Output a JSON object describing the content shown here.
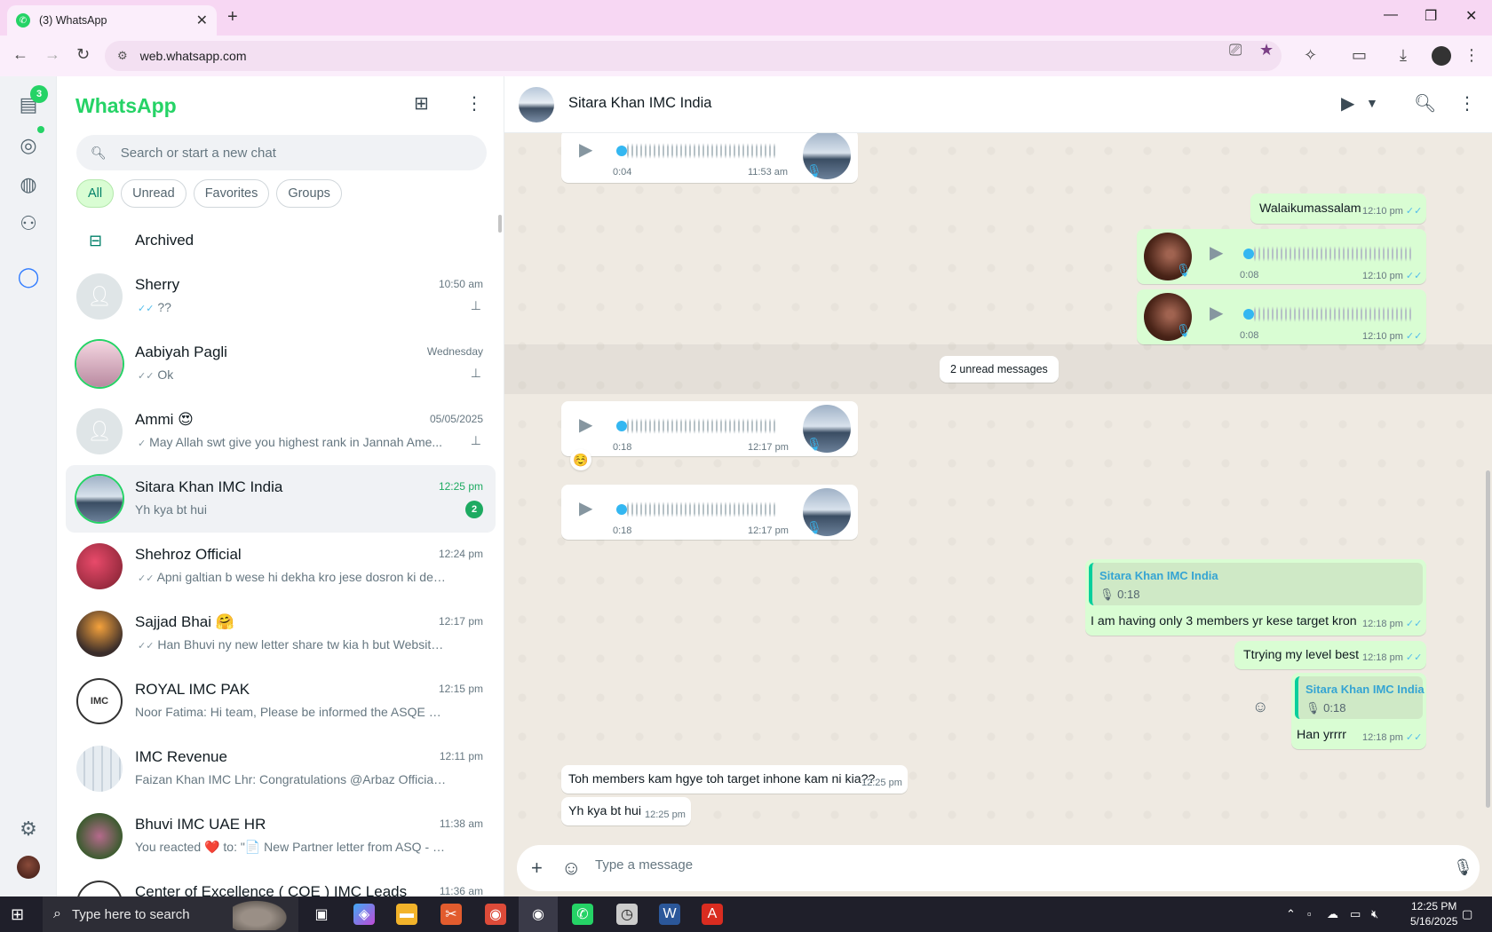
{
  "browser": {
    "tab_title": "(3) WhatsApp",
    "url": "web.whatsapp.com",
    "window_buttons": [
      "—",
      "❐",
      "✕"
    ]
  },
  "rail": {
    "chats_badge": "3"
  },
  "sidebar": {
    "brand": "WhatsApp",
    "search_placeholder": "Search or start a new chat",
    "filters": [
      "All",
      "Unread",
      "Favorites",
      "Groups"
    ],
    "archived_label": "Archived",
    "chats": [
      {
        "name": "Sherry",
        "time": "10:50 am",
        "tick": "✓✓",
        "preview": "??",
        "pinned": true
      },
      {
        "name": "Aabiyah Pagli",
        "time": "Wednesday",
        "tick": "✓✓",
        "preview": "Ok",
        "pinned": true
      },
      {
        "name": "Ammi 😍",
        "time": "05/05/2025",
        "tick": "✓",
        "preview": "May Allah swt give you highest rank in Jannah  Ame...",
        "pinned": true
      },
      {
        "name": "Sitara Khan IMC India",
        "time": "12:25 pm",
        "tick": "",
        "preview": "Yh kya bt hui",
        "unread": "2"
      },
      {
        "name": "Shehroz Official",
        "time": "12:24 pm",
        "tick": "✓✓",
        "preview": "Apni galtian b wese hi dekha kro jese dosron ki dekhty ..."
      },
      {
        "name": "Sajjad Bhai 🤗",
        "time": "12:17 pm",
        "tick": "✓✓",
        "preview": "Han Bhuvi ny new letter share tw kia h but Website pe h..."
      },
      {
        "name": "ROYAL IMC PAK",
        "time": "12:15 pm",
        "tick": "",
        "preview": "Noor Fatima: Hi team, Please be informed the ASQE Memb..."
      },
      {
        "name": "IMC Revenue",
        "time": "12:11 pm",
        "tick": "",
        "preview": "Faizan Khan IMC Lhr: Congratulations @Arbaz Official Bro"
      },
      {
        "name": "Bhuvi IMC UAE HR",
        "time": "11:38 am",
        "tick": "",
        "preview": "You reacted ❤️ to: \"📄 New Partner letter from ASQ - Can I..."
      },
      {
        "name": "Center of Excellence ( COE ) IMC Leads",
        "time": "11:36 am",
        "tick": "",
        "preview": ""
      }
    ]
  },
  "conversation": {
    "contact_name": "Sitara Khan IMC India",
    "unread_divider": "2 unread messages",
    "composer_placeholder": "Type a message",
    "messages": {
      "voice_top": {
        "duration": "0:04",
        "time": "11:53 am"
      },
      "walaikum": {
        "text": "Walaikumassalam",
        "time": "12:10 pm"
      },
      "voice_out_1": {
        "duration": "0:08",
        "time": "12:10 pm"
      },
      "voice_out_2": {
        "duration": "0:08",
        "time": "12:10 pm"
      },
      "voice_in_1": {
        "duration": "0:18",
        "time": "12:17 pm",
        "reaction": "☺️"
      },
      "voice_in_2": {
        "duration": "0:18",
        "time": "12:17 pm"
      },
      "reply_1": {
        "quote_name": "Sitara Khan IMC India",
        "quote_duration": "0:18",
        "text": "I am having only 3 members yr kese target kron",
        "time": "12:18 pm"
      },
      "trying": {
        "text": "Ttrying my level best",
        "time": "12:18 pm"
      },
      "reply_2": {
        "quote_name": "Sitara Khan IMC India",
        "quote_duration": "0:18",
        "text": "Han yrrrr",
        "time": "12:18 pm"
      },
      "in_text_1": {
        "text": "Toh members kam hgye toh target inhone kam ni kia??",
        "time": "12:25 pm"
      },
      "in_text_2": {
        "text": "Yh kya bt hui",
        "time": "12:25 pm"
      }
    }
  },
  "taskbar": {
    "search_placeholder": "Type here to search",
    "time": "12:25 PM",
    "date": "5/16/2025"
  },
  "colors": {
    "brand": "#25d366",
    "outgoing_bubble": "#d9fdd3",
    "read_ticks": "#53bdeb",
    "chrome_bg": "#f7d7f3"
  }
}
